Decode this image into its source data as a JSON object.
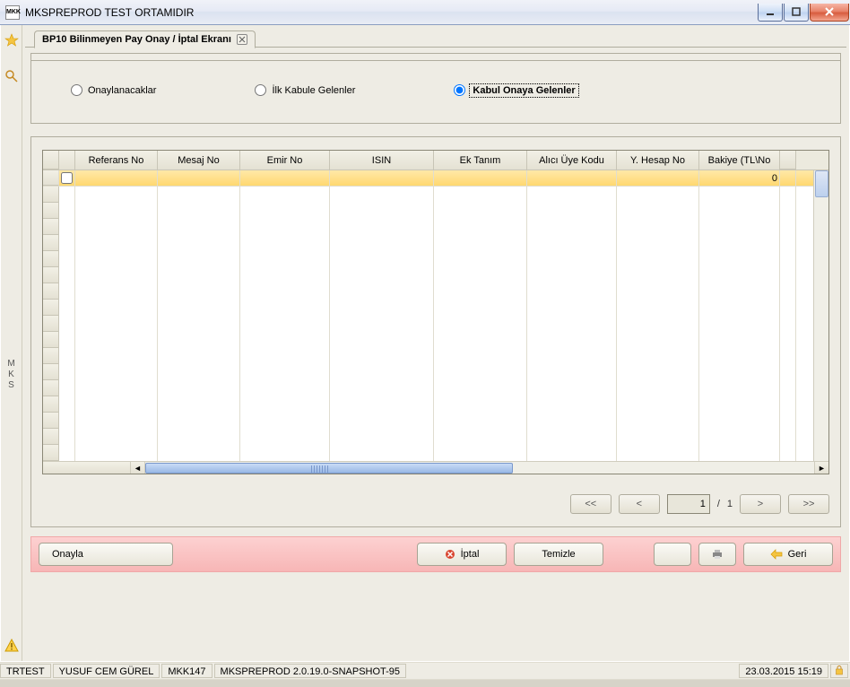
{
  "window": {
    "title": "MKSPREPROD TEST ORTAMIDIR",
    "app_icon_text": "MKK"
  },
  "tab": {
    "title": "BP10 Bilinmeyen Pay Onay / İptal Ekranı"
  },
  "sidebar": {
    "vertical_label_chars": [
      "M",
      "K",
      "S"
    ]
  },
  "filter": {
    "options": [
      {
        "label": "Onaylanacaklar",
        "selected": false
      },
      {
        "label": "İlk Kabule Gelenler",
        "selected": false
      },
      {
        "label": "Kabul Onaya Gelenler",
        "selected": true
      }
    ]
  },
  "grid": {
    "columns": [
      "Referans No",
      "Mesaj No",
      "Emir No",
      "ISIN",
      "Ek Tanım",
      "Alıcı Üye Kodu",
      "Y. Hesap No",
      "Bakiye (TL\\No"
    ],
    "row_zero_right": "0",
    "empty_row_count": 17
  },
  "pager": {
    "first": "<<",
    "prev": "<",
    "next": ">",
    "last": ">>",
    "page": "1",
    "sep": "/",
    "total": "1"
  },
  "buttons": {
    "approve": "Onayla",
    "cancel": "İptal",
    "clear": "Temizle",
    "back": "Geri"
  },
  "status": {
    "env": "TRTEST",
    "user": "YUSUF CEM GÜREL",
    "code": "MKK147",
    "version": "MKSPREPROD 2.0.19.0-SNAPSHOT-95",
    "datetime": "23.03.2015 15:19"
  }
}
